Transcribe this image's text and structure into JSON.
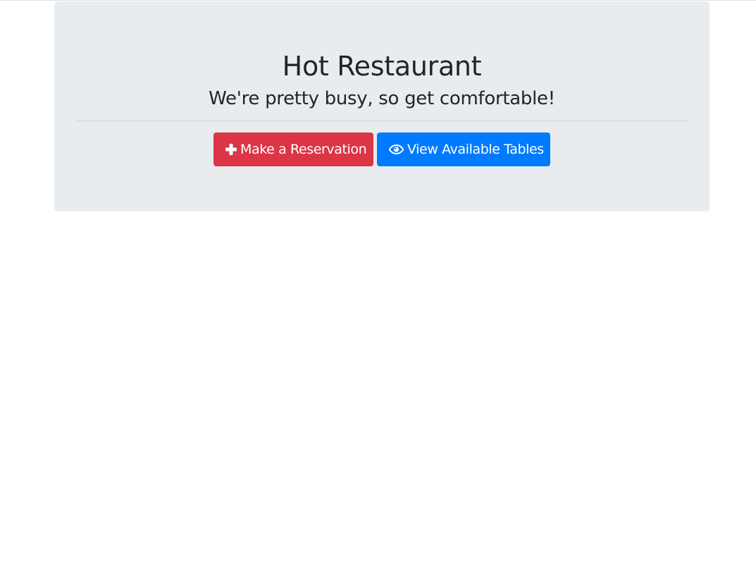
{
  "jumbotron": {
    "title": "Hot Restaurant",
    "subtitle": "We're pretty busy, so get comfortable!"
  },
  "buttons": {
    "reserve": {
      "label": "Make a Reservation",
      "icon": "plus-icon",
      "color": "#dc3545"
    },
    "view": {
      "label": "View Available Tables",
      "icon": "eye-icon",
      "color": "#007bff"
    }
  },
  "colors": {
    "jumbotron_bg": "#e9ecef",
    "text": "#212529"
  }
}
